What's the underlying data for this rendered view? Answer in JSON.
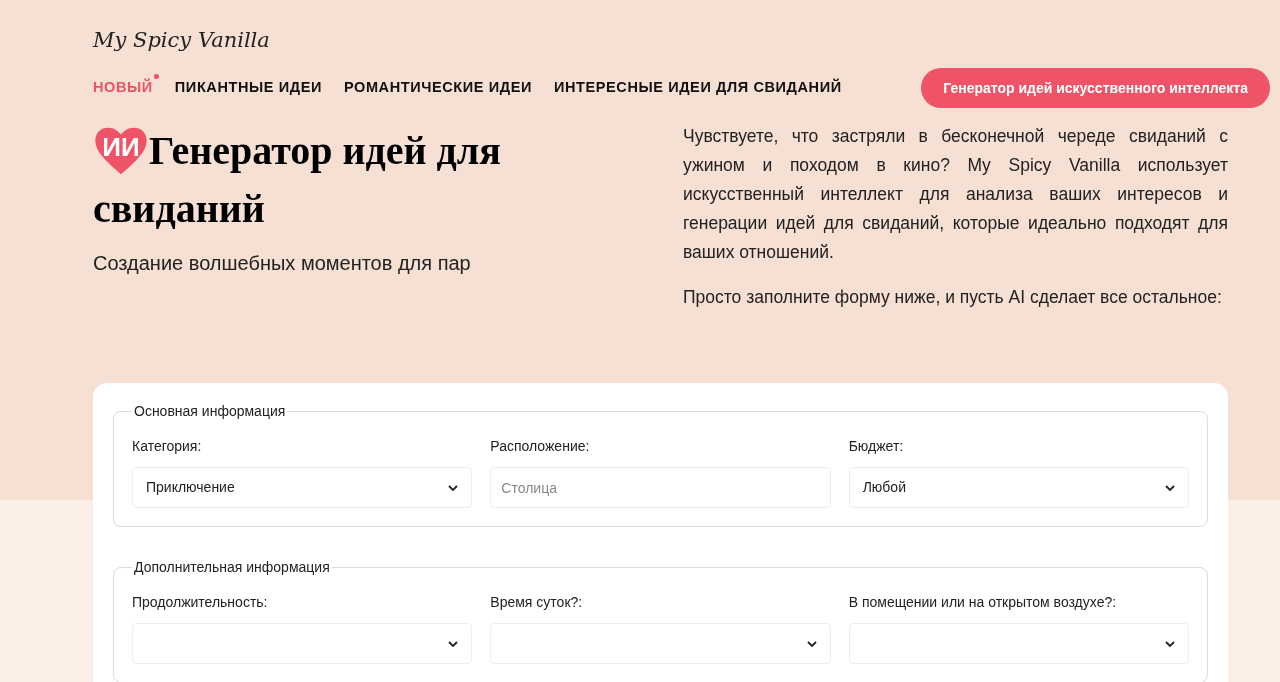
{
  "logo": "My Spicy Vanilla",
  "nav": [
    {
      "label": "НОВЫЙ",
      "selected": true,
      "dot": true
    },
    {
      "label": "ПИКАНТНЫЕ ИДЕИ",
      "selected": false,
      "dot": false
    },
    {
      "label": "РОМАНТИЧЕСКИЕ ИДЕИ",
      "selected": false,
      "dot": false
    },
    {
      "label": "ИНТЕРЕСНЫЕ ИДЕИ ДЛЯ СВИДАНИЙ",
      "selected": false,
      "dot": false
    }
  ],
  "cta_button": "Генератор идей искусственного интеллекта",
  "hero": {
    "badge": "ИИ",
    "title_lines": [
      "Генератор идей для",
      "свиданий"
    ],
    "subtitle": "Создание волшебных моментов для пар",
    "paragraphs": [
      "Чувствуете, что застряли в бесконечной череде свиданий с ужином и походом в кино? My Spicy Vanilla использует искусственный интеллект для анализа ваших интересов и генерации идей для свиданий, которые идеально подходят для ваших отношений.",
      "Просто заполните форму ниже, и пусть AI сделает все остальное:"
    ]
  },
  "form": {
    "sections": [
      {
        "legend": "Основная информация",
        "fields": [
          {
            "label": "Категория:",
            "kind": "select",
            "value": "Приключение"
          },
          {
            "label": "Расположение:",
            "kind": "text",
            "placeholder": "Столица"
          },
          {
            "label": "Бюджет:",
            "kind": "select",
            "value": "Любой"
          }
        ]
      },
      {
        "legend": "Дополнительная информация",
        "fields": [
          {
            "label": "Продолжительность:",
            "kind": "select"
          },
          {
            "label": "Время суток?:",
            "kind": "select"
          },
          {
            "label": "В помещении или на открытом воздухе?:",
            "kind": "select"
          }
        ]
      }
    ]
  }
}
